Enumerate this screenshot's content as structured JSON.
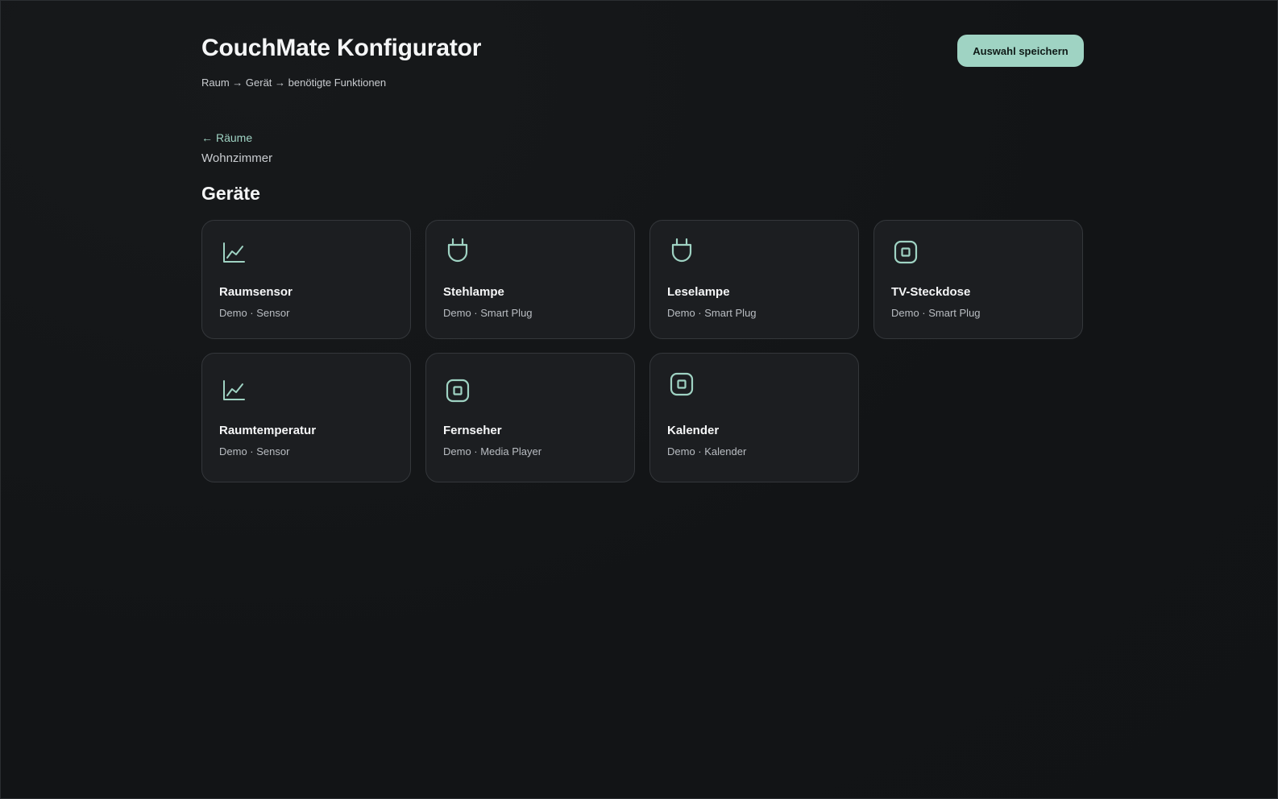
{
  "header": {
    "title": "CouchMate Konfigurator",
    "breadcrumb": "Raum → Gerät → benötigte Funktionen",
    "save_label": "Auswahl speichern"
  },
  "navigation": {
    "back_arrow": "←",
    "back_label": "Räume",
    "current_room": "Wohnzimmer"
  },
  "devices_section": {
    "title": "Geräte",
    "accent_color": "#9fd3c3",
    "devices": [
      {
        "name": "Raumsensor",
        "meta": "Demo · Sensor",
        "icon": "chart-line-icon"
      },
      {
        "name": "Stehlampe",
        "meta": "Demo · Smart Plug",
        "icon": "plug-icon"
      },
      {
        "name": "Leselampe",
        "meta": "Demo · Smart Plug",
        "icon": "plug-icon"
      },
      {
        "name": "TV-Steckdose",
        "meta": "Demo · Smart Plug",
        "icon": "square-chip-icon"
      },
      {
        "name": "Raumtemperatur",
        "meta": "Demo · Sensor",
        "icon": "chart-line-icon"
      },
      {
        "name": "Fernseher",
        "meta": "Demo · Media Player",
        "icon": "square-chip-icon"
      },
      {
        "name": "Kalender",
        "meta": "Demo · Kalender",
        "icon": "square-chip-icon"
      }
    ]
  }
}
